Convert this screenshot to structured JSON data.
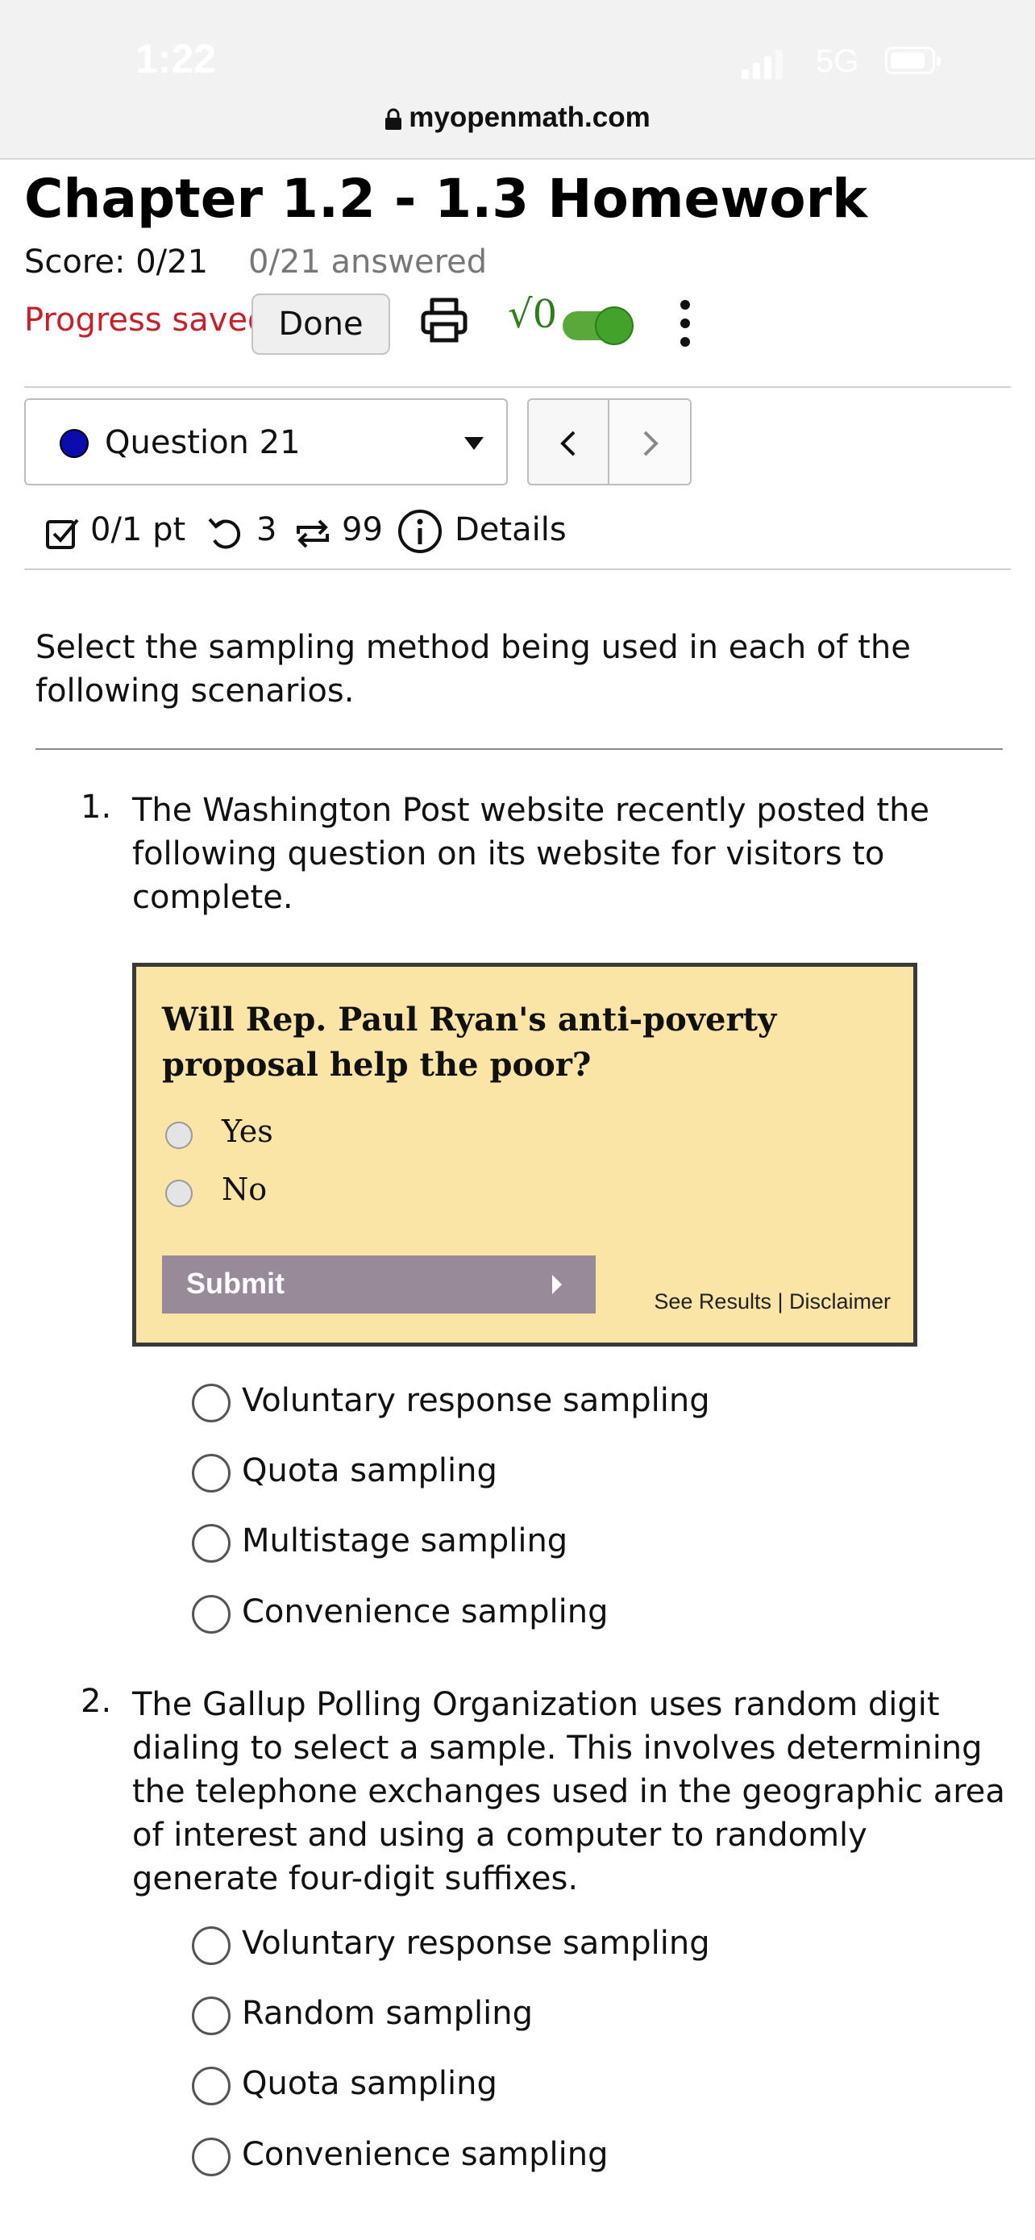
{
  "status_bar": {
    "time": "1:22",
    "network": "5G"
  },
  "browser": {
    "url": "myopenmath.com"
  },
  "header": {
    "title": "Chapter 1.2 - 1.3 Homework",
    "score": "Score: 0/21",
    "answered": "0/21 answered",
    "progress": "Progress saved",
    "done_label": "Done",
    "math_symbol": "√0"
  },
  "navigation": {
    "question_label": "Question 21"
  },
  "meta": {
    "points": "0/1 pt",
    "retries": "3",
    "attempts": "99",
    "details": "Details"
  },
  "instructions": "Select the sampling method being used in each of the following scenarios.",
  "questions": [
    {
      "number": "1.",
      "text": "The Washington Post website recently posted the following question on its website for visitors to complete.",
      "poll": {
        "title": "Will Rep. Paul Ryan's anti-poverty proposal help the poor?",
        "options": [
          "Yes",
          "No"
        ],
        "submit": "Submit",
        "links": "See Results | Disclaimer"
      },
      "choices": [
        "Voluntary response sampling",
        "Quota sampling",
        "Multistage sampling",
        "Convenience sampling"
      ]
    },
    {
      "number": "2.",
      "text": "The Gallup Polling Organization uses random digit dialing to select a sample. This involves determining the telephone exchanges used in the geographic area of interest and using a computer to randomly generate four-digit suffixes.",
      "choices": [
        "Voluntary response sampling",
        "Random sampling",
        "Quota sampling",
        "Convenience sampling"
      ]
    }
  ]
}
